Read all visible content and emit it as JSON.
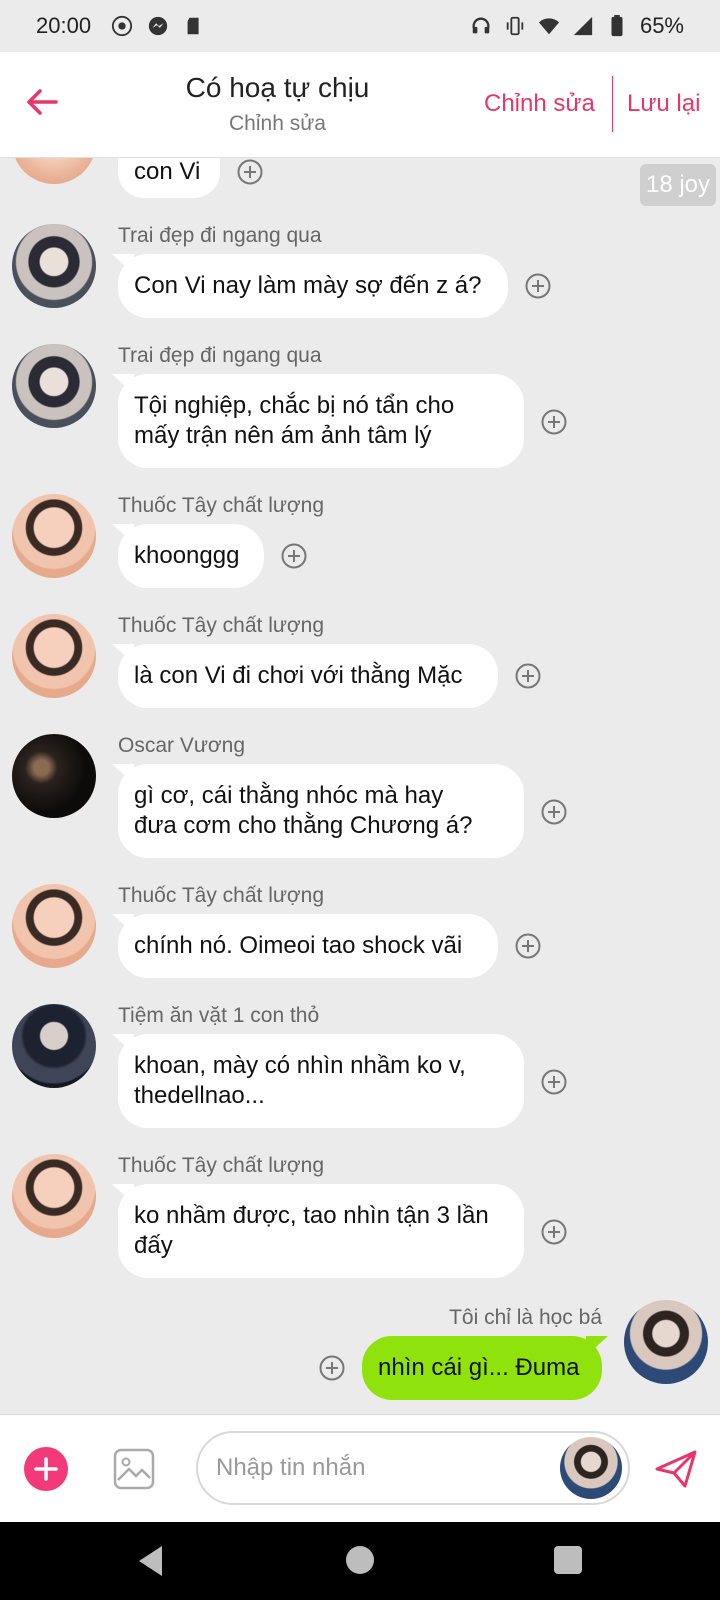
{
  "status_bar": {
    "time": "20:00",
    "battery": "65%"
  },
  "header": {
    "title": "Có hoạ tự chịu",
    "subtitle": "Chỉnh sửa",
    "edit_label": "Chỉnh sửa",
    "save_label": "Lưu lại"
  },
  "chat": {
    "badge": "18 joy",
    "top_partial_text": "con Vi",
    "messages": [
      {
        "sender": "Trai đẹp đi ngang qua",
        "lines": [
          "Con Vi nay làm mày sợ đến z á?"
        ]
      },
      {
        "sender": "Trai đẹp đi ngang qua",
        "lines": [
          "Tội nghiệp, chắc bị nó tẩn cho",
          "mấy trận nên ám ảnh tâm lý"
        ]
      },
      {
        "sender": "Thuốc Tây chất lượng",
        "lines": [
          "khoonggg"
        ]
      },
      {
        "sender": "Thuốc Tây chất lượng",
        "lines": [
          "là con Vi đi chơi với thằng Mặc"
        ]
      },
      {
        "sender": "Oscar Vương",
        "lines": [
          "gì cơ, cái thằng nhóc mà hay",
          "đưa cơm cho thằng Chương á?"
        ]
      },
      {
        "sender": "Thuốc Tây chất lượng",
        "lines": [
          "chính nó. Oimeoi tao shock vãi"
        ]
      },
      {
        "sender": "Tiệm ăn vặt 1 con thỏ",
        "lines": [
          "khoan, mày có nhìn nhầm ko v,",
          "thedellnao..."
        ]
      },
      {
        "sender": "Thuốc Tây chất lượng",
        "lines": [
          "ko nhầm được, tao nhìn tận 3 lần",
          "đấy"
        ]
      }
    ],
    "my_message": {
      "sender": "Tôi chỉ là học bá",
      "text": "nhìn cái gì... Đuma"
    }
  },
  "composer": {
    "placeholder": "Nhập tin nhắn"
  },
  "colors": {
    "accent": "#e8356c",
    "my_bubble": "#8fe20b",
    "background": "#ebebeb"
  }
}
